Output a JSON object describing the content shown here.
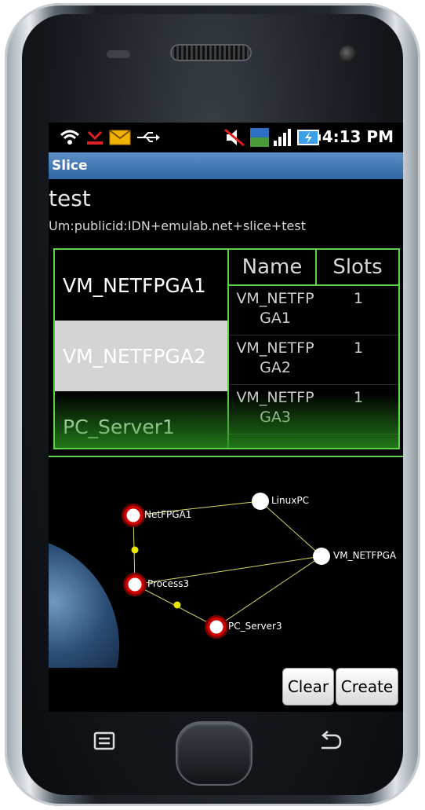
{
  "status_bar": {
    "time": "4:13 PM",
    "icons": [
      "wifi-icon",
      "missed-call-icon",
      "email-icon",
      "usb-icon",
      "mute-icon",
      "3g-icon",
      "signal-icon",
      "battery-icon"
    ]
  },
  "title_bar": {
    "title": "Slice"
  },
  "slice": {
    "name": "test",
    "urn": "Um:publicid:IDN+emulab.net+slice+test"
  },
  "node_list": {
    "items": [
      {
        "label": "VM_NETFPGA1",
        "selected": false
      },
      {
        "label": "VM_NETFPGA2",
        "selected": true
      },
      {
        "label": "PC_Server1",
        "selected": false
      }
    ]
  },
  "table": {
    "headers": [
      "Name",
      "Slots"
    ],
    "rows": [
      {
        "name": "VM_NETFPGA1",
        "slots": "1"
      },
      {
        "name": "VM_NETFPGA2",
        "slots": "1"
      },
      {
        "name": "VM_NETFPGA3",
        "slots": "1"
      }
    ]
  },
  "graph": {
    "nodes": [
      "NetFPGA1",
      "LinuxPC",
      "VM_NETFPGA",
      "Process3",
      "PC_Server3"
    ]
  },
  "buttons": {
    "clear": "Clear",
    "create": "Create"
  },
  "colors": {
    "accent_green": "#5fd04a",
    "title_blue": "#3b73b3",
    "link_yellow": "#e8e800",
    "node_red": "#cc0000"
  }
}
